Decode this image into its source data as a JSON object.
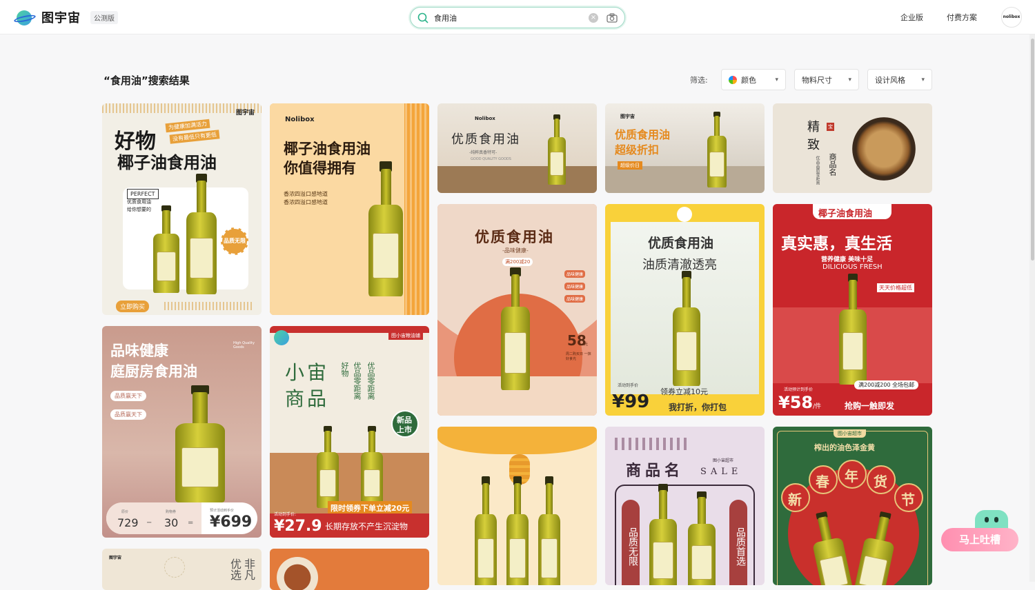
{
  "header": {
    "logo_text": "图宇宙",
    "beta": "公测版",
    "search_value": "食用油",
    "nav": [
      "企业版",
      "付费方案"
    ],
    "avatar_text": "nolibox"
  },
  "results": {
    "title": "“食用油”搜索结果",
    "filter_label": "筛选:",
    "filters": [
      "颜色",
      "物料尺寸",
      "设计风格"
    ]
  },
  "cards": {
    "c1": {
      "brand": "图宇宙",
      "slogan": "为健康加满活力",
      "sub": "没有最低只有更低",
      "title1": "好物",
      "title2": "椰子油食用油",
      "tag": "PERFECT",
      "tag2": "优质食用油",
      "tag3": "给你想要的",
      "badge": "品质无限",
      "cta": "立即购买"
    },
    "c2": {
      "brand": "Nolibox",
      "title1": "椰子油食用油",
      "title2": "你值得拥有",
      "line1": "香浓四溢口感地道",
      "line2": "香浓四溢口感地道"
    },
    "c3": {
      "brand": "Nolibox",
      "title": "优质食用油",
      "sub": "-纯粹真香特可-",
      "sub2": "GOOD QUALITY GOODS"
    },
    "c4": {
      "brand": "图宇宙",
      "title1": "优质食用油",
      "title2": "超级折扣",
      "badge": "超级价日"
    },
    "c5": {
      "title1": "精",
      "title2": "致",
      "stamp": "宝",
      "title3": "商品名",
      "desc": "优品品质零距离"
    },
    "c6": {
      "title": "优质食用油",
      "sub": "-品味健康-",
      "badge": "满200减20",
      "tags": [
        "品味健康",
        "品味健康",
        "品味健康"
      ],
      "price": "58",
      "unit": "元",
      "note": "周二购买日 一抹好食光"
    },
    "c7": {
      "title1": "优质食用油",
      "title2": "油质清澈透亮",
      "price_label": "活动到手价",
      "price": "99",
      "promo": "领券立减10元",
      "slogan": "我打折，你打包"
    },
    "c8": {
      "ribbon": "椰子油食用油",
      "title": "真实惠，真生活",
      "sub": "营养健康 美味十足",
      "sub_en": "DILICIOUS FRESH",
      "tag": "天天价格超低",
      "promo": "满200减200 全场包邮",
      "price_label": "活动预计到手价",
      "price": "58",
      "unit": "/件",
      "cta": "抢购一触即发"
    },
    "c9": {
      "title1": "品味健康",
      "title2": "庭厨房食用油",
      "en": "High Quality Goods",
      "pill1": "品质赢天下",
      "pill2": "品质赢天下",
      "l1": "原价",
      "v1": "729",
      "l2": "购物券",
      "v2": "30",
      "l3": "预计活动到手价",
      "v3": "699"
    },
    "c10": {
      "shop": "图小宙粮油铺",
      "title1": "小宙",
      "title2": "商品",
      "col1": "好物",
      "col2": "优品零距离",
      "col3": "优品零距离",
      "badge1": "新品",
      "badge2": "上市",
      "promo": "限时领券下单立减20元",
      "price_label": "活动到手价:",
      "price": "27.9",
      "slogan": "长期存放不产生沉淀物"
    },
    "c11": {},
    "c12": {
      "title": "商品名",
      "shop": "图小宙超市",
      "sale": "SALE",
      "left": "品质无限",
      "right": "品质首选"
    },
    "c13": {
      "shop": "图小宙超市",
      "title": "榨出的油色泽金黄",
      "chars": [
        "新",
        "春",
        "年",
        "货",
        "节"
      ]
    },
    "c14": {
      "brand": "图宇宙",
      "col1": "非凡",
      "col2": "优选"
    }
  },
  "feedback": {
    "label": "马上吐槽"
  }
}
